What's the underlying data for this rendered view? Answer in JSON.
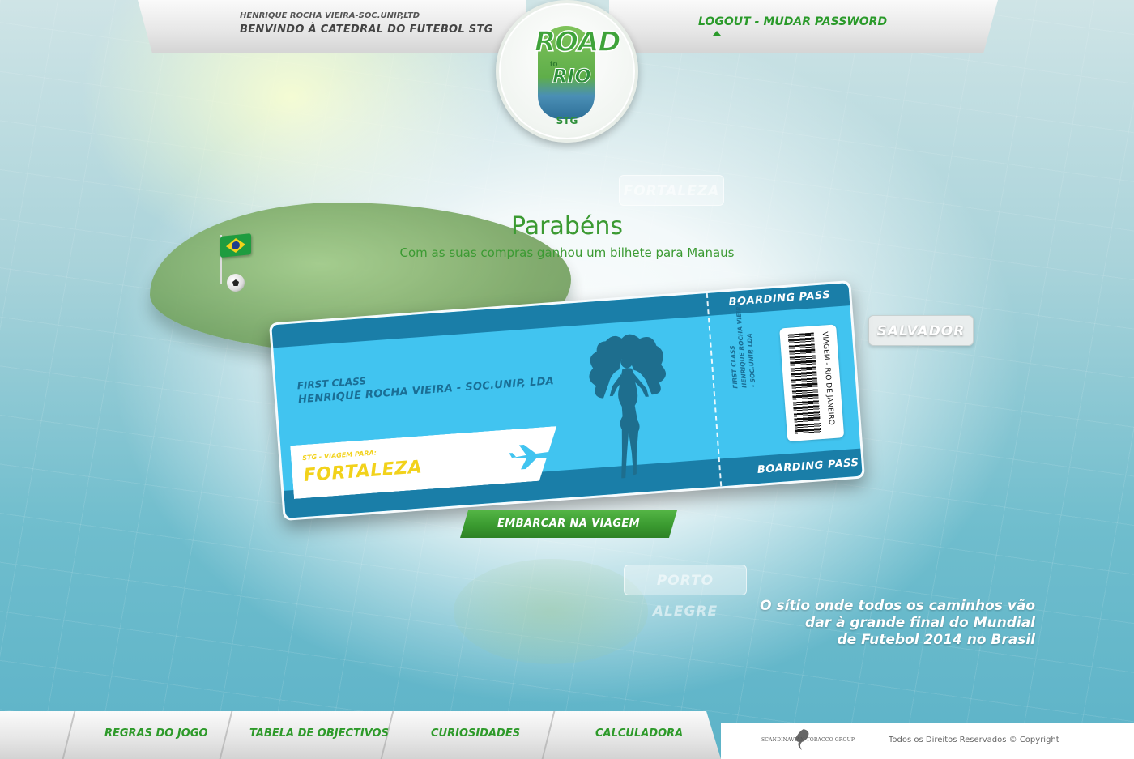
{
  "header": {
    "user_name": "HENRIQUE ROCHA VIEIRA-SOC.UNIP,LTD",
    "welcome": "BENVINDO À CATEDRAL DO FUTEBOL STG",
    "logout_label": "LOGOUT",
    "separator": "-",
    "change_password_label": "MUDAR PASSWORD"
  },
  "logo": {
    "word_top": "ROAD",
    "word_to": "to",
    "word_bottom": "RIO",
    "brand": "STG"
  },
  "map": {
    "cities": [
      "FORTALEZA",
      "SALVADOR",
      "PORTO ALEGRE"
    ]
  },
  "congrats": {
    "title": "Parabéns",
    "subtitle": "Com as suas compras ganhou um bilhete para Manaus"
  },
  "ticket": {
    "boarding_pass_label": "BOARDING PASS",
    "class": "FIRST CLASS",
    "passenger": "HENRIQUE ROCHA VIEIRA - SOC.UNIP, LDA",
    "destination_caption": "STG - VIAGEM PARA:",
    "destination": "FORTALEZA",
    "stub_class": "FIRST CLASS",
    "stub_passenger": "HENRIQUE ROCHA VIEIRA - SOC.UNIP, LDA",
    "barcode_text": "VIAGEM - RIO DE JANEIRO"
  },
  "actions": {
    "board_button": "EMBARCAR NA VIAGEM"
  },
  "tagline": {
    "line1": "O sítio onde todos os caminhos vão",
    "line2": "dar à grande final do Mundial",
    "line3": "de Futebol 2014 no Brasil"
  },
  "footer": {
    "nav": [
      "REGRAS DO JOGO",
      "TABELA DE OBJECTIVOS",
      "CURIOSIDADES",
      "CALCULADORA"
    ],
    "sponsor": "SCANDINAVIAN TOBACCO GROUP",
    "copyright": "Todos os Direitos Reservados © Copyright"
  },
  "colors": {
    "brand_green": "#3b9a32",
    "ticket_blue": "#41c4f0",
    "ticket_dark_blue": "#1a7ea8",
    "destination_yellow": "#f2d21b"
  }
}
